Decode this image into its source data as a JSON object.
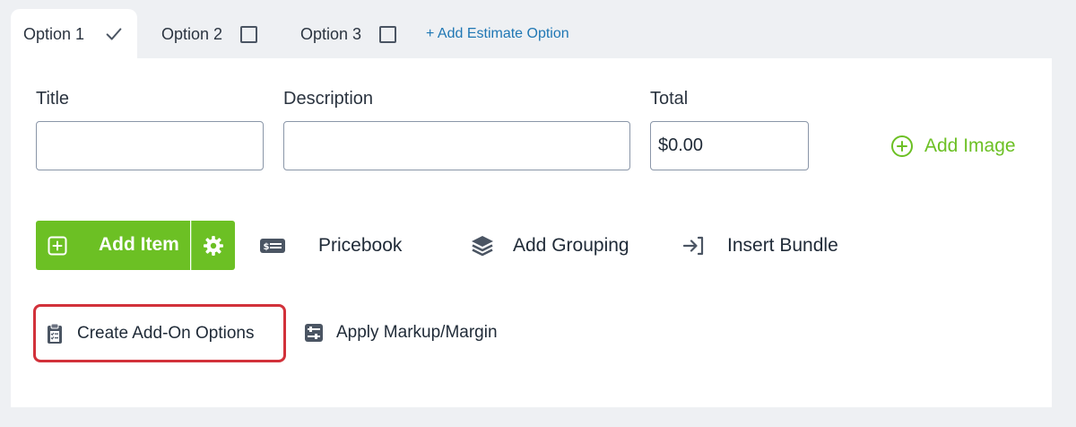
{
  "tabs": [
    {
      "label": "Option 1",
      "state": "checked"
    },
    {
      "label": "Option 2",
      "state": "unchecked"
    },
    {
      "label": "Option 3",
      "state": "unchecked"
    }
  ],
  "add_option_label": "+ Add Estimate Option",
  "form": {
    "title_label": "Title",
    "title_value": "",
    "description_label": "Description",
    "description_value": "",
    "total_label": "Total",
    "total_value": "$0.00"
  },
  "add_image_label": "Add Image",
  "toolbar": {
    "add_item_label": "Add Item",
    "pricebook_label": "Pricebook",
    "add_grouping_label": "Add Grouping",
    "insert_bundle_label": "Insert Bundle"
  },
  "actions": {
    "create_addon_label": "Create Add-On Options",
    "apply_markup_label": "Apply Markup/Margin"
  },
  "colors": {
    "accent_green": "#6cc024",
    "link_blue": "#1f77b4",
    "highlight_red": "#d2313a"
  },
  "icons": {
    "tab_checked": "check-icon",
    "tab_unchecked": "checkbox-icon",
    "add_image": "plus-circle-icon",
    "add_item": "plus-square-icon",
    "settings": "gear-icon",
    "pricebook": "price-tag-icon",
    "grouping": "layers-icon",
    "bundle": "sign-in-icon",
    "addon": "clipboard-icon",
    "markup": "sliders-icon"
  }
}
